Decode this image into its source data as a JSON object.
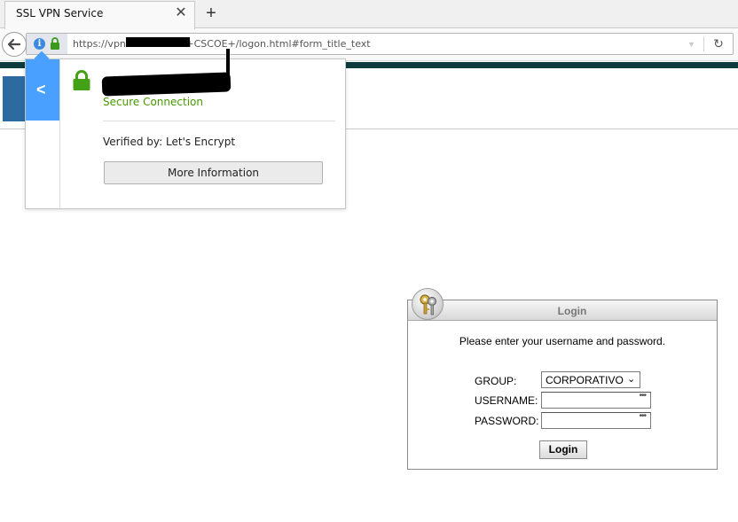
{
  "browser": {
    "tab_title": "SSL VPN Service",
    "tab_close_glyph": "✕",
    "new_tab_glyph": "+",
    "url_prefix": "https://vpn.",
    "url_suffix": "+CSCOE+/logon.html#form_title_text",
    "reload_glyph": "↻"
  },
  "identity_popup": {
    "secure_label": "Secure Connection",
    "verified_by": "Verified by: Let's Encrypt",
    "more_info_label": "More Information",
    "back_glyph": "<"
  },
  "login": {
    "title": "Login",
    "prompt": "Please enter your username and password.",
    "group_label": "GROUP:",
    "group_value": "CORPORATIVO",
    "username_label": "USERNAME:",
    "password_label": "PASSWORD:",
    "autofill_dots": "•••",
    "submit_label": "Login"
  },
  "colors": {
    "header_bar": "#0e3b3d",
    "popup_accent": "#49a0ff",
    "secure_green": "#479900"
  },
  "icons": [
    "back-arrow-icon",
    "info-icon",
    "lock-icon",
    "reload-icon",
    "keys-icon",
    "chevron-left-icon"
  ]
}
